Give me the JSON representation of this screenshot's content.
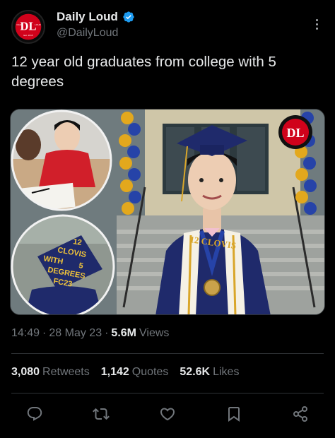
{
  "author": {
    "display_name": "Daily Loud",
    "handle": "@DailyLoud",
    "avatar_logo": "DL",
    "avatar_small_text_left": "DAILY",
    "avatar_small_text_right": "LOUD",
    "avatar_sub_text": "Est. 2015",
    "verified": true
  },
  "tweet": {
    "text": "12 year old graduates from college with 5 degrees"
  },
  "media": {
    "cap_text": [
      "12",
      "CLOVIS",
      "WITH",
      "5",
      "DEGREES",
      "FC23"
    ],
    "stole_text": "12 CLOVIS",
    "watermark_logo": "DL"
  },
  "meta": {
    "time": "14:49",
    "date": "28 May 23",
    "separator": "·",
    "views_count": "5.6M",
    "views_label": "Views"
  },
  "stats": {
    "retweets_count": "3,080",
    "retweets_label": "Retweets",
    "quotes_count": "1,142",
    "quotes_label": "Quotes",
    "likes_count": "52.6K",
    "likes_label": "Likes"
  },
  "icons": {
    "reply": "reply-icon",
    "retweet": "retweet-icon",
    "like": "heart-icon",
    "bookmark": "bookmark-icon",
    "share": "share-icon",
    "more": "more-icon",
    "verified": "verified-badge-icon"
  },
  "colors": {
    "background": "#000000",
    "text_primary": "#e7e9ea",
    "text_secondary": "#71767b",
    "verified": "#1d9bf0",
    "logo_red": "#d0021b",
    "gown_navy": "#1f2a6b",
    "gold": "#d9a62a"
  }
}
